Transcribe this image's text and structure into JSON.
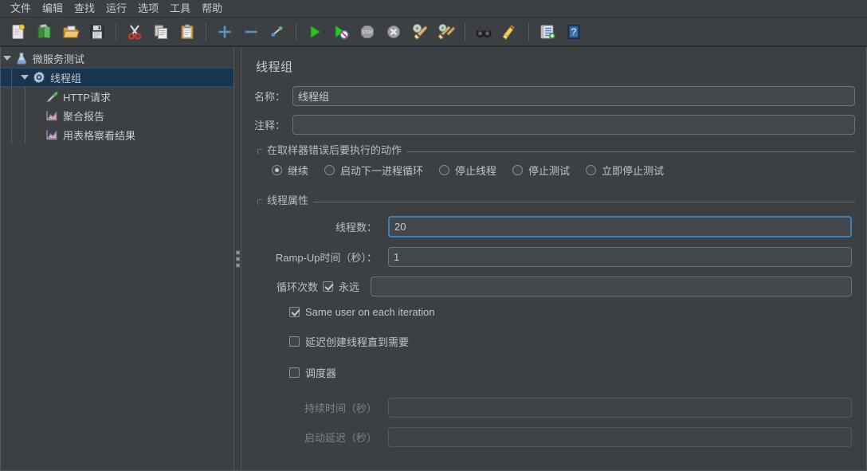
{
  "window": {
    "bg": "#3c4043",
    "accent": "#3f7fb5",
    "selection_bg": "#17354f"
  },
  "menubar": {
    "items": [
      {
        "label": "文件",
        "name": "menu-file"
      },
      {
        "label": "编辑",
        "name": "menu-edit"
      },
      {
        "label": "查找",
        "name": "menu-search"
      },
      {
        "label": "运行",
        "name": "menu-run"
      },
      {
        "label": "选项",
        "name": "menu-options"
      },
      {
        "label": "工具",
        "name": "menu-tools"
      },
      {
        "label": "帮助",
        "name": "menu-help"
      }
    ]
  },
  "toolbar": {
    "buttons": [
      {
        "icon": "new-document-icon",
        "name": "toolbar-new"
      },
      {
        "icon": "new-from-template-icon",
        "name": "toolbar-templates"
      },
      {
        "icon": "open-folder-icon",
        "name": "toolbar-open"
      },
      {
        "icon": "save-icon",
        "name": "toolbar-save"
      },
      {
        "icon": "separator",
        "name": "toolbar-separator-1"
      },
      {
        "icon": "cut-scissors-icon",
        "name": "toolbar-cut"
      },
      {
        "icon": "copy-icon",
        "name": "toolbar-copy"
      },
      {
        "icon": "paste-clipboard-icon",
        "name": "toolbar-paste"
      },
      {
        "icon": "separator",
        "name": "toolbar-separator-2"
      },
      {
        "icon": "expand-plus-icon",
        "name": "toolbar-expand-all"
      },
      {
        "icon": "collapse-minus-icon",
        "name": "toolbar-collapse-all"
      },
      {
        "icon": "toggle-element-icon",
        "name": "toolbar-toggle"
      },
      {
        "icon": "separator",
        "name": "toolbar-separator-3"
      },
      {
        "icon": "start-play-icon",
        "name": "toolbar-start"
      },
      {
        "icon": "start-no-pauses-icon",
        "name": "toolbar-start-no-pauses"
      },
      {
        "icon": "stop-sign-icon",
        "name": "toolbar-stop"
      },
      {
        "icon": "shutdown-x-icon",
        "name": "toolbar-shutdown"
      },
      {
        "icon": "clear-gear-broom-icon",
        "name": "toolbar-clear"
      },
      {
        "icon": "clear-all-broom-icon",
        "name": "toolbar-clear-all"
      },
      {
        "icon": "separator",
        "name": "toolbar-separator-4"
      },
      {
        "icon": "binoculars-search-icon",
        "name": "toolbar-search"
      },
      {
        "icon": "broom-reset-search-icon",
        "name": "toolbar-reset-search"
      },
      {
        "icon": "separator",
        "name": "toolbar-separator-5"
      },
      {
        "icon": "function-helper-icon",
        "name": "toolbar-function-helper"
      },
      {
        "icon": "help-book-icon",
        "name": "toolbar-help"
      }
    ]
  },
  "tree": {
    "nodes": [
      {
        "label": "微服务测试",
        "icon": "test-plan-icon",
        "depth": 0,
        "expanded": true,
        "selected": false,
        "name": "tree-node-test-plan"
      },
      {
        "label": "线程组",
        "icon": "thread-group-icon",
        "depth": 1,
        "expanded": true,
        "selected": true,
        "name": "tree-node-thread-group"
      },
      {
        "label": "HTTP请求",
        "icon": "http-request-icon",
        "depth": 2,
        "expanded": null,
        "selected": false,
        "name": "tree-node-http-request"
      },
      {
        "label": "聚合报告",
        "icon": "aggregate-report-icon",
        "depth": 2,
        "expanded": null,
        "selected": false,
        "name": "tree-node-aggregate-report"
      },
      {
        "label": "用表格察看结果",
        "icon": "view-results-table-icon",
        "depth": 2,
        "expanded": null,
        "selected": false,
        "name": "tree-node-view-results-table"
      }
    ]
  },
  "form": {
    "title": "线程组",
    "name_label": "名称：",
    "name_value": "线程组",
    "name_placeholder": "",
    "comment_label": "注释：",
    "comment_value": "",
    "comment_placeholder": "",
    "error_action": {
      "legend": "在取样器错误后要执行的动作",
      "options": [
        {
          "label": "继续",
          "selected": true,
          "name": "radio-continue"
        },
        {
          "label": "启动下一进程循环",
          "selected": false,
          "name": "radio-start-next-loop"
        },
        {
          "label": "停止线程",
          "selected": false,
          "name": "radio-stop-thread"
        },
        {
          "label": "停止测试",
          "selected": false,
          "name": "radio-stop-test"
        },
        {
          "label": "立即停止测试",
          "selected": false,
          "name": "radio-stop-test-now"
        }
      ]
    },
    "thread_properties": {
      "legend": "线程属性",
      "num_threads_label": "线程数：",
      "num_threads_value": "20",
      "ramp_up_label": "Ramp-Up时间（秒）：",
      "ramp_up_value": "1",
      "loop_count_label": "循环次数",
      "forever_label": "永远",
      "forever_checked": true,
      "loop_count_value": "",
      "same_user_label": "Same user on each iteration",
      "same_user_checked": true,
      "delay_create_label": "延迟创建线程直到需要",
      "delay_create_checked": false,
      "scheduler_label": "调度器",
      "scheduler_checked": false,
      "duration_label": "持续时间（秒）",
      "duration_value": "",
      "duration_disabled": true,
      "startup_delay_label": "启动延迟（秒）",
      "startup_delay_value": "",
      "startup_delay_disabled": true
    }
  }
}
